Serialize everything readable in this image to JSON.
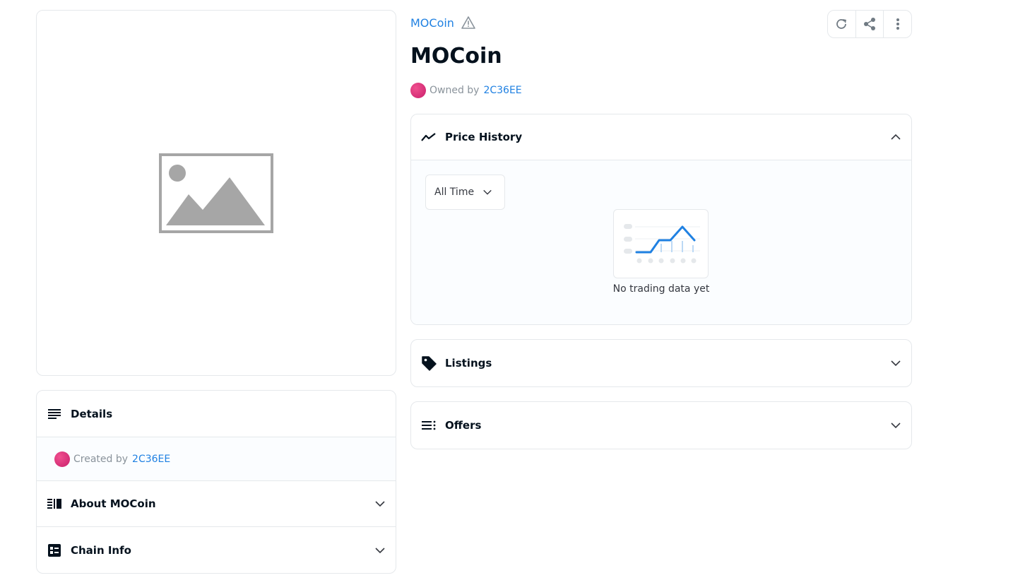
{
  "colors": {
    "accent": "#2081e2",
    "border": "#e5e8eb",
    "avatar": "#e22f7c",
    "panel_bg": "#fbfdff"
  },
  "left": {
    "image_placeholder": "broken-image-icon",
    "details": {
      "title": "Details",
      "created_by_label": "Created by",
      "creator": "2C36EE"
    },
    "about": {
      "title": "About MOCoin"
    },
    "chain": {
      "title": "Chain Info"
    }
  },
  "right": {
    "collection_name": "MOCoin",
    "title": "MOCoin",
    "owned_by_label": "Owned by",
    "owner": "2C36EE",
    "price_history": {
      "title": "Price History",
      "period": "All Time",
      "empty_text": "No trading data yet"
    },
    "listings": {
      "title": "Listings"
    },
    "offers": {
      "title": "Offers"
    }
  }
}
